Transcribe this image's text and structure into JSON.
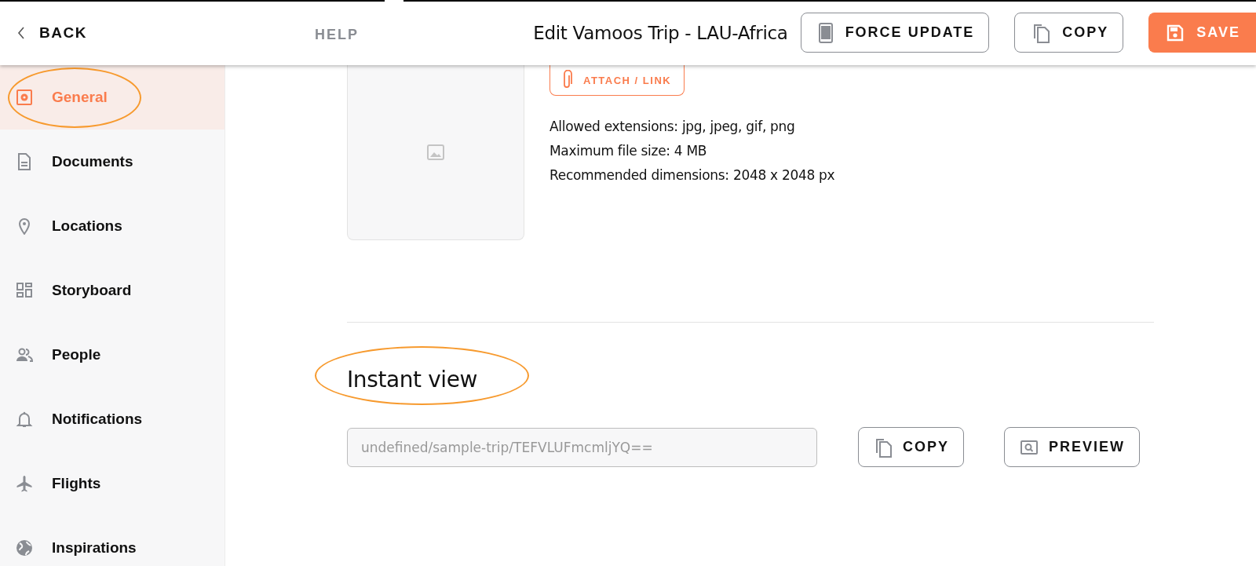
{
  "header": {
    "back": "BACK",
    "help": "HELP",
    "title": "Edit Vamoos Trip - LAU-Africa",
    "buttons": [
      {
        "label": "FORCE UPDATE",
        "kind": "phone"
      },
      {
        "label": "COPY",
        "kind": "copy"
      },
      {
        "label": "SAVE",
        "kind": "save"
      }
    ]
  },
  "sidebar": {
    "items": [
      {
        "label": "General",
        "selected": true,
        "circled": true
      },
      {
        "label": "Documents",
        "selected": false,
        "circled": false
      },
      {
        "label": "Locations",
        "selected": false,
        "circled": false
      },
      {
        "label": "Storyboard",
        "selected": false,
        "circled": false
      },
      {
        "label": "People",
        "selected": false,
        "circled": false
      },
      {
        "label": "Notifications",
        "selected": false,
        "circled": false
      },
      {
        "label": "Flights",
        "selected": false,
        "circled": false
      },
      {
        "label": "Inspirations",
        "selected": false,
        "circled": false
      }
    ]
  },
  "image_upload": {
    "attach_button": "ATTACH / LINK",
    "info": [
      "Allowed extensions: jpg, jpeg, gif, png",
      "Maximum file size: 4 MB",
      "Recommended dimensions: 2048 x 2048 px"
    ]
  },
  "instant_view": {
    "title": "Instant view",
    "circled": true,
    "url_field": {
      "value": "undefined/sample-trip/TEFVLUFmcmljYQ=="
    },
    "buttons": [
      {
        "label": "COPY",
        "kind": "copy"
      },
      {
        "label": "PREVIEW",
        "kind": "preview"
      }
    ]
  }
}
